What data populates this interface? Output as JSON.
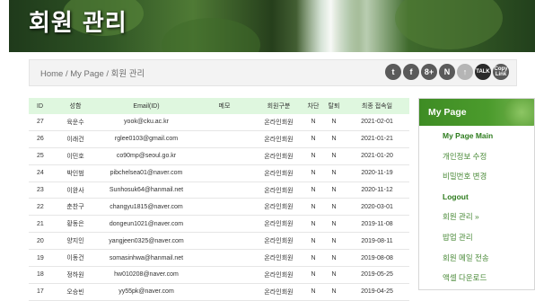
{
  "banner": {
    "title": "회원 관리"
  },
  "breadcrumb": {
    "text": "Home / My Page / 회원 관리"
  },
  "social": [
    {
      "icon": "twitter-icon",
      "glyph": "t"
    },
    {
      "icon": "facebook-icon",
      "glyph": "f"
    },
    {
      "icon": "google-plus-icon",
      "glyph": "8+"
    },
    {
      "icon": "naver-icon",
      "glyph": "N"
    },
    {
      "icon": "share-icon",
      "glyph": "↑"
    },
    {
      "icon": "kakaotalk-icon",
      "glyph": "TALK"
    },
    {
      "icon": "copy-link-icon",
      "glyph": "Copy Link"
    }
  ],
  "table": {
    "headers": [
      "ID",
      "성함",
      "Email(ID)",
      "메모",
      "회원구분",
      "차단",
      "탈퇴",
      "최종 접속일"
    ],
    "rows": [
      [
        "27",
        "육운수",
        "yook@cku.ac.kr",
        "",
        "온라인회원",
        "N",
        "N",
        "2021-02-01"
      ],
      [
        "26",
        "이래건",
        "rglee0103@gmail.com",
        "",
        "온라인회원",
        "N",
        "N",
        "2021-01-21"
      ],
      [
        "25",
        "이민호",
        "co90mp@seoul.go.kr",
        "",
        "온라인회원",
        "N",
        "N",
        "2021-01-20"
      ],
      [
        "24",
        "박인범",
        "pibchelsea01@naver.com",
        "",
        "온라인회원",
        "N",
        "N",
        "2020-11-19"
      ],
      [
        "23",
        "이완사",
        "Sunhosuk64@hanmail.net",
        "",
        "온라인회원",
        "N",
        "N",
        "2020-11-12"
      ],
      [
        "22",
        "춘찬구",
        "changyu1815@naver.com",
        "",
        "온라인회원",
        "N",
        "N",
        "2020-03-01"
      ],
      [
        "21",
        "황동은",
        "dongeun1021@naver.com",
        "",
        "온라인회원",
        "N",
        "N",
        "2019-11-08"
      ],
      [
        "20",
        "양지인",
        "yangjeen0325@naver.com",
        "",
        "온라인회원",
        "N",
        "N",
        "2019-08-11"
      ],
      [
        "19",
        "이동건",
        "somasinhwa@hanmail.net",
        "",
        "온라인회원",
        "N",
        "N",
        "2019-08-08"
      ],
      [
        "18",
        "정하원",
        "hw010208@naver.com",
        "",
        "온라인회원",
        "N",
        "N",
        "2019-05-25"
      ],
      [
        "17",
        "오승빈",
        "yy55pk@naver.com",
        "",
        "온라인회원",
        "N",
        "N",
        "2019-04-25"
      ]
    ]
  },
  "side_menu": {
    "title": "My Page",
    "items": [
      "My Page Main",
      "개인정보 수정",
      "비밀번호 변경",
      "Logout",
      "회원 관리 »",
      "밥업 관리",
      "회원 메일 전송",
      "액셀 다운로드"
    ]
  },
  "colors": {
    "accent_green": "#4b9b2c",
    "table_header_bg": "#dff7df",
    "menu_text": "#2f7d1f"
  }
}
